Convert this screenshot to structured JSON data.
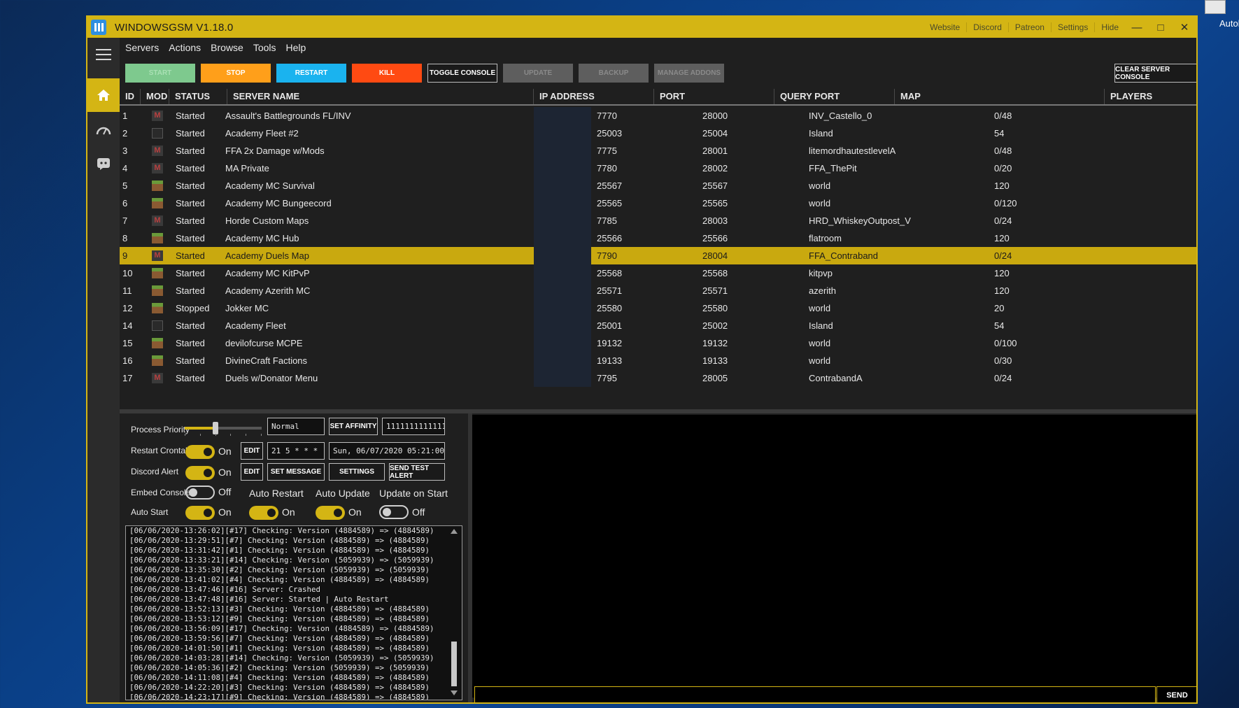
{
  "desktop": {
    "icon_label": "Autol"
  },
  "window": {
    "title": "WINDOWSGSM V1.18.0",
    "links": [
      "Website",
      "Discord",
      "Patreon",
      "Settings",
      "Hide"
    ],
    "controls": {
      "minimize": "—",
      "maximize": "□",
      "close": "✕"
    }
  },
  "menu": [
    "Servers",
    "Actions",
    "Browse",
    "Tools",
    "Help"
  ],
  "toolbar": {
    "start": "START",
    "stop": "STOP",
    "restart": "RESTART",
    "kill": "KILL",
    "toggle_console": "TOGGLE CONSOLE",
    "update": "UPDATE",
    "backup": "BACKUP",
    "manage_addons": "MANAGE ADDONS",
    "clear_console": "CLEAR SERVER CONSOLE"
  },
  "colors": {
    "accent": "#d4b514",
    "start": "#7ec98e",
    "stop": "#ff9f1a",
    "restart": "#1ab3ef",
    "kill": "#ff4a12"
  },
  "grid": {
    "columns": [
      "ID",
      "MOD",
      "STATUS",
      "SERVER NAME",
      "IP ADDRESS",
      "PORT",
      "QUERY PORT",
      "MAP",
      "PLAYERS"
    ],
    "selected_row": 8,
    "rows": [
      {
        "id": "1",
        "mod": "m",
        "status": "Started",
        "name": "Assault's Battlegrounds FL/INV",
        "port": "7770",
        "query": "28000",
        "map": "INV_Castello_0",
        "players": "0/48"
      },
      {
        "id": "2",
        "mod": "fleet",
        "status": "Started",
        "name": "Academy Fleet #2",
        "port": "25003",
        "query": "25004",
        "map": "Island",
        "players": "54"
      },
      {
        "id": "3",
        "mod": "m",
        "status": "Started",
        "name": "FFA 2x Damage w/Mods",
        "port": "7775",
        "query": "28001",
        "map": "litemordhautestlevelA",
        "players": "0/48"
      },
      {
        "id": "4",
        "mod": "m",
        "status": "Started",
        "name": "MA Private",
        "port": "7780",
        "query": "28002",
        "map": "FFA_ThePit",
        "players": "0/20"
      },
      {
        "id": "5",
        "mod": "grass",
        "status": "Started",
        "name": "Academy MC Survival",
        "port": "25567",
        "query": "25567",
        "map": "world",
        "players": "120"
      },
      {
        "id": "6",
        "mod": "grass",
        "status": "Started",
        "name": "Academy MC Bungeecord",
        "port": "25565",
        "query": "25565",
        "map": "world",
        "players": "0/120"
      },
      {
        "id": "7",
        "mod": "m",
        "status": "Started",
        "name": "Horde Custom Maps",
        "port": "7785",
        "query": "28003",
        "map": "HRD_WhiskeyOutpost_V",
        "players": "0/24"
      },
      {
        "id": "8",
        "mod": "grass",
        "status": "Started",
        "name": "Academy MC Hub",
        "port": "25566",
        "query": "25566",
        "map": "flatroom",
        "players": "120"
      },
      {
        "id": "9",
        "mod": "m",
        "status": "Started",
        "name": "Academy Duels Map",
        "port": "7790",
        "query": "28004",
        "map": "FFA_Contraband",
        "players": "0/24"
      },
      {
        "id": "10",
        "mod": "grass",
        "status": "Started",
        "name": "Academy MC KitPvP",
        "port": "25568",
        "query": "25568",
        "map": "kitpvp",
        "players": "120"
      },
      {
        "id": "11",
        "mod": "grass",
        "status": "Started",
        "name": "Academy Azerith MC",
        "port": "25571",
        "query": "25571",
        "map": "azerith",
        "players": "120"
      },
      {
        "id": "12",
        "mod": "grass",
        "status": "Stopped",
        "name": "Jokker MC",
        "port": "25580",
        "query": "25580",
        "map": "world",
        "players": "20"
      },
      {
        "id": "14",
        "mod": "fleet",
        "status": "Started",
        "name": "Academy Fleet",
        "port": "25001",
        "query": "25002",
        "map": "Island",
        "players": "54"
      },
      {
        "id": "15",
        "mod": "grass",
        "status": "Started",
        "name": "devilofcurse MCPE",
        "port": "19132",
        "query": "19132",
        "map": "world",
        "players": "0/100"
      },
      {
        "id": "16",
        "mod": "grass",
        "status": "Started",
        "name": "DivineCraft Factions",
        "port": "19133",
        "query": "19133",
        "map": "world",
        "players": "0/30"
      },
      {
        "id": "17",
        "mod": "m",
        "status": "Started",
        "name": "Duels w/Donator Menu",
        "port": "7795",
        "query": "28005",
        "map": "ContrabandA",
        "players": "0/24"
      }
    ]
  },
  "settings": {
    "process_priority_label": "Process Priority",
    "priority_value": "Normal",
    "priority_level": 0.4,
    "set_affinity": "SET AFFINITY",
    "affinity_value": "1111111111111",
    "restart_crontab_label": "Restart Crontab",
    "crontab_state": "On",
    "edit": "EDIT",
    "crontab_value": "21 5 * * *",
    "next_restart": "Sun, 06/07/2020 05:21:00",
    "discord_alert_label": "Discord Alert",
    "discord_state": "On",
    "set_message": "SET MESSAGE",
    "settings": "SETTINGS",
    "send_test_alert": "SEND TEST ALERT",
    "embed_console_label": "Embed Console",
    "embed_state": "Off",
    "auto_restart_label": "Auto Restart",
    "auto_update_label": "Auto Update",
    "update_on_start_label": "Update on Start",
    "auto_start_label": "Auto Start",
    "auto_start_state": "On",
    "auto_restart_state": "On",
    "auto_update_state": "On",
    "update_on_start_state": "Off"
  },
  "log": [
    "[06/06/2020-13:26:02][#17] Checking: Version (4884589) => (4884589)",
    "[06/06/2020-13:29:51][#7] Checking: Version (4884589) => (4884589)",
    "[06/06/2020-13:31:42][#1] Checking: Version (4884589) => (4884589)",
    "[06/06/2020-13:33:21][#14] Checking: Version (5059939) => (5059939)",
    "[06/06/2020-13:35:30][#2] Checking: Version (5059939) => (5059939)",
    "[06/06/2020-13:41:02][#4] Checking: Version (4884589) => (4884589)",
    "[06/06/2020-13:47:46][#16] Server: Crashed",
    "[06/06/2020-13:47:48][#16] Server: Started | Auto Restart",
    "[06/06/2020-13:52:13][#3] Checking: Version (4884589) => (4884589)",
    "[06/06/2020-13:53:12][#9] Checking: Version (4884589) => (4884589)",
    "[06/06/2020-13:56:09][#17] Checking: Version (4884589) => (4884589)",
    "[06/06/2020-13:59:56][#7] Checking: Version (4884589) => (4884589)",
    "[06/06/2020-14:01:50][#1] Checking: Version (4884589) => (4884589)",
    "[06/06/2020-14:03:28][#14] Checking: Version (5059939) => (5059939)",
    "[06/06/2020-14:05:36][#2] Checking: Version (5059939) => (5059939)",
    "[06/06/2020-14:11:08][#4] Checking: Version (4884589) => (4884589)",
    "[06/06/2020-14:22:20][#3] Checking: Version (4884589) => (4884589)",
    "[06/06/2020-14:23:17][#9] Checking: Version (4884589) => (4884589)"
  ],
  "console": {
    "send": "SEND",
    "input_value": ""
  }
}
